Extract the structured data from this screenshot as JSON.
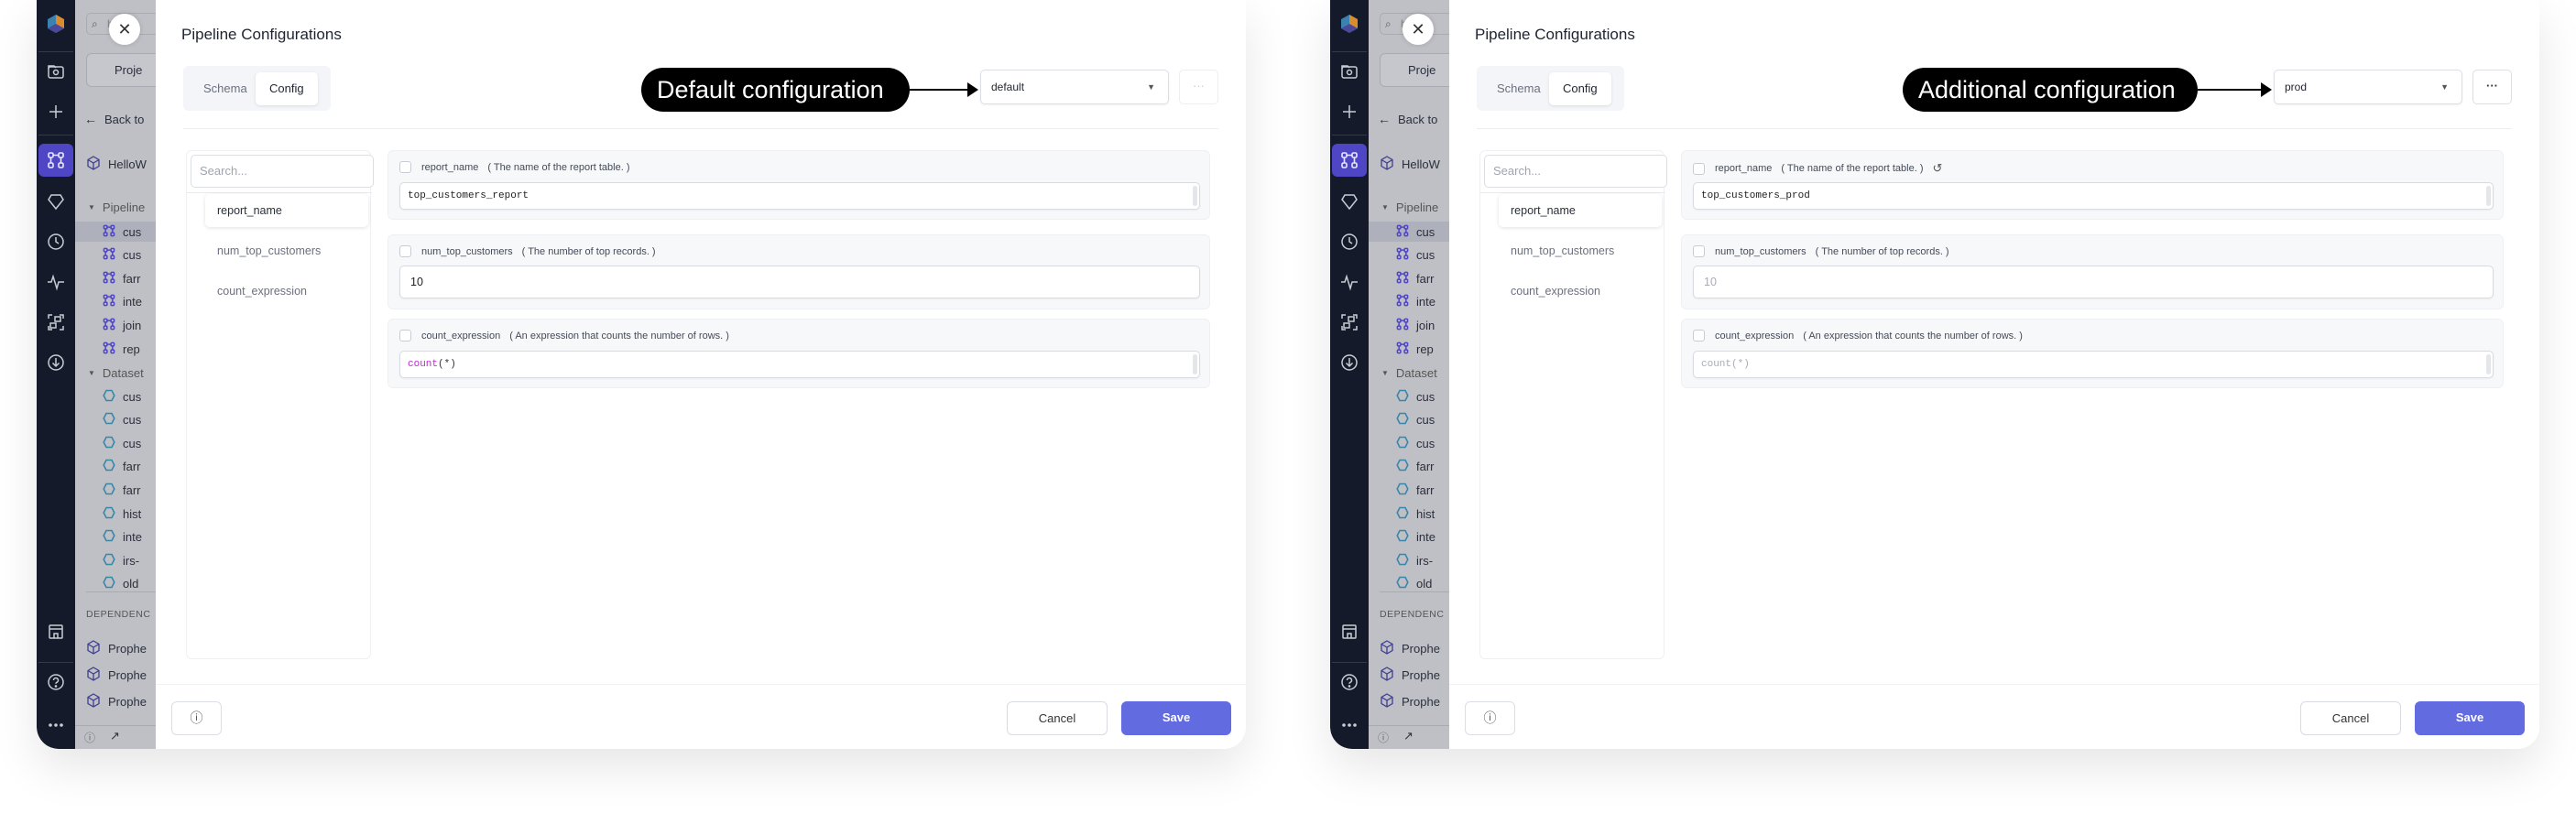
{
  "colors": {
    "accent": "#636be0",
    "sidebar": "#141a29",
    "active_nav": "#4f46c5",
    "function_token": "#c026d3"
  },
  "windows": [
    {
      "sidebar_icons": [
        "logo-icon",
        "folder-search-icon",
        "plus-icon",
        "pipeline-icon",
        "diamond-icon",
        "clock-icon",
        "pulse-icon",
        "graph-icon",
        "download-icon",
        "store-icon",
        "help-icon",
        "more-icon"
      ],
      "explorer": {
        "search_fragment": "h",
        "project_button": "Proje",
        "back": "Back to",
        "project": "HelloW",
        "pipelines_heading": "Pipeline",
        "pipelines": [
          "cus",
          "cus",
          "farr",
          "inte",
          "join",
          "rep"
        ],
        "datasets_heading": "Dataset",
        "datasets": [
          "cus",
          "cus",
          "cus",
          "farr",
          "farr",
          "hist",
          "inte",
          "irs-",
          "old"
        ],
        "dependencies_heading": "DEPENDENC",
        "dependencies": [
          "Prophe",
          "Prophe",
          "Prophe"
        ]
      },
      "modal": {
        "title": "Pipeline Configurations",
        "tabs": [
          {
            "label": "Schema",
            "active": false
          },
          {
            "label": "Config",
            "active": true
          }
        ],
        "callout": "Default configuration",
        "config_select": "default",
        "more_enabled": false,
        "more_label": "···",
        "search_placeholder": "Search...",
        "list": [
          {
            "label": "report_name",
            "active": true
          },
          {
            "label": "num_top_customers",
            "active": false
          },
          {
            "label": "count_expression",
            "active": false
          }
        ],
        "fields": [
          {
            "name": "report_name",
            "description": "( The name of the report table. )",
            "value": "top_customers_report",
            "mono": true,
            "muted": false,
            "reset": false
          },
          {
            "name": "num_top_customers",
            "description": "( The number of top records. )",
            "value": "10",
            "mono": false,
            "muted": false,
            "reset": false
          },
          {
            "name": "count_expression",
            "description": "( An expression that counts the number of rows. )",
            "value": "count(*)",
            "mono": true,
            "muted": false,
            "reset": false,
            "tokens": [
              {
                "text": "count",
                "color": "#c026d3"
              },
              {
                "text": "(*)",
                "color": "#333333"
              }
            ]
          }
        ],
        "cancel": "Cancel",
        "save": "Save"
      }
    },
    {
      "sidebar_icons": [
        "logo-icon",
        "folder-search-icon",
        "plus-icon",
        "pipeline-icon",
        "diamond-icon",
        "clock-icon",
        "pulse-icon",
        "graph-icon",
        "download-icon",
        "store-icon",
        "help-icon",
        "more-icon"
      ],
      "explorer": {
        "search_fragment": "h",
        "project_button": "Proje",
        "back": "Back to",
        "project": "HelloW",
        "pipelines_heading": "Pipeline",
        "pipelines": [
          "cus",
          "cus",
          "farr",
          "inte",
          "join",
          "rep"
        ],
        "datasets_heading": "Dataset",
        "datasets": [
          "cus",
          "cus",
          "cus",
          "farr",
          "farr",
          "hist",
          "inte",
          "irs-",
          "old"
        ],
        "dependencies_heading": "DEPENDENC",
        "dependencies": [
          "Prophe",
          "Prophe",
          "Prophe"
        ]
      },
      "modal": {
        "title": "Pipeline Configurations",
        "tabs": [
          {
            "label": "Schema",
            "active": false
          },
          {
            "label": "Config",
            "active": true
          }
        ],
        "callout": "Additional configuration",
        "config_select": "prod",
        "more_enabled": true,
        "more_label": "···",
        "search_placeholder": "Search...",
        "list": [
          {
            "label": "report_name",
            "active": true
          },
          {
            "label": "num_top_customers",
            "active": false
          },
          {
            "label": "count_expression",
            "active": false
          }
        ],
        "fields": [
          {
            "name": "report_name",
            "description": "( The name of the report table. )",
            "value": "top_customers_prod",
            "mono": true,
            "muted": false,
            "reset": true
          },
          {
            "name": "num_top_customers",
            "description": "( The number of top records. )",
            "value": "10",
            "mono": false,
            "muted": true,
            "reset": false
          },
          {
            "name": "count_expression",
            "description": "( An expression that counts the number of rows. )",
            "value": "count(*)",
            "mono": true,
            "muted": true,
            "reset": false
          }
        ],
        "cancel": "Cancel",
        "save": "Save"
      }
    }
  ]
}
